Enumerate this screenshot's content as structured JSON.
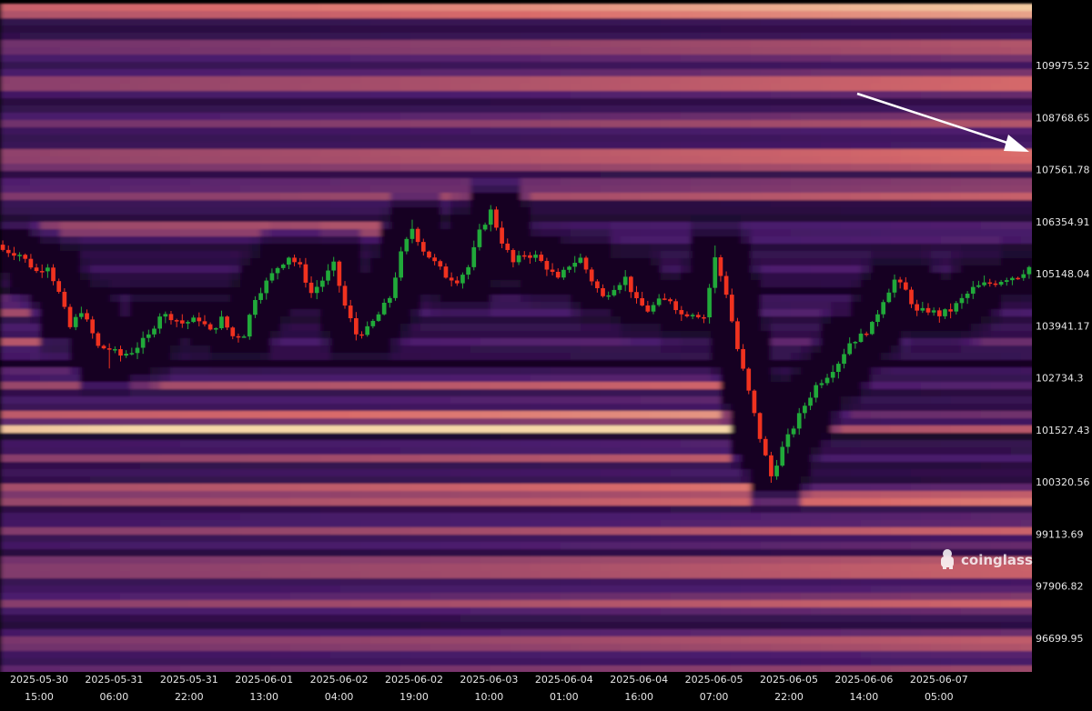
{
  "chart_data": {
    "type": "heatmap",
    "subtype": "liquidation-heatmap-with-candlesticks",
    "title": "",
    "xlabel": "",
    "ylabel": "",
    "y_ticks": [
      "109975.52",
      "108768.65",
      "107561.78",
      "106354.91",
      "105148.04",
      "103941.17",
      "102734.3",
      "101527.43",
      "100320.56",
      "99113.69",
      "97906.82",
      "96699.95"
    ],
    "ylim": [
      95850,
      111750
    ],
    "x_ticks": [
      {
        "date": "2025-05-30",
        "time": "15:00"
      },
      {
        "date": "2025-05-31",
        "time": "06:00"
      },
      {
        "date": "2025-05-31",
        "time": "22:00"
      },
      {
        "date": "2025-06-01",
        "time": "13:00"
      },
      {
        "date": "2025-06-02",
        "time": "04:00"
      },
      {
        "date": "2025-06-02",
        "time": "19:00"
      },
      {
        "date": "2025-06-03",
        "time": "10:00"
      },
      {
        "date": "2025-06-04",
        "time": "01:00"
      },
      {
        "date": "2025-06-04",
        "time": "16:00"
      },
      {
        "date": "2025-06-05",
        "time": "07:00"
      },
      {
        "date": "2025-06-05",
        "time": "22:00"
      },
      {
        "date": "2025-06-06",
        "time": "14:00"
      },
      {
        "date": "2025-06-07",
        "time": "05:00"
      }
    ],
    "candle_interval_hours": 1.6,
    "price_path": [
      [
        0,
        105700
      ],
      [
        3,
        105600
      ],
      [
        6,
        105200
      ],
      [
        8,
        105350
      ],
      [
        10,
        104700
      ],
      [
        12,
        103900
      ],
      [
        14,
        104300
      ],
      [
        16,
        103750
      ],
      [
        17,
        103450
      ],
      [
        19,
        103400
      ],
      [
        21,
        103250
      ],
      [
        23,
        103350
      ],
      [
        26,
        103700
      ],
      [
        28,
        104200
      ],
      [
        30,
        104150
      ],
      [
        32,
        104000
      ],
      [
        35,
        104100
      ],
      [
        37,
        103800
      ],
      [
        39,
        104100
      ],
      [
        41,
        103700
      ],
      [
        43,
        103750
      ],
      [
        45,
        104600
      ],
      [
        47,
        104950
      ],
      [
        49,
        105300
      ],
      [
        51,
        105550
      ],
      [
        53,
        105300
      ],
      [
        55,
        104700
      ],
      [
        57,
        105000
      ],
      [
        59,
        105350
      ],
      [
        61,
        104400
      ],
      [
        63,
        103750
      ],
      [
        65,
        103850
      ],
      [
        67,
        104200
      ],
      [
        69,
        104600
      ],
      [
        71,
        105600
      ],
      [
        73,
        106200
      ],
      [
        75,
        105700
      ],
      [
        77,
        105400
      ],
      [
        79,
        105100
      ],
      [
        81,
        105000
      ],
      [
        83,
        105300
      ],
      [
        85,
        106100
      ],
      [
        87,
        106600
      ],
      [
        89,
        105900
      ],
      [
        91,
        105400
      ],
      [
        93,
        105600
      ],
      [
        95,
        105550
      ],
      [
        97,
        105300
      ],
      [
        99,
        105000
      ],
      [
        101,
        105350
      ],
      [
        103,
        105500
      ],
      [
        105,
        105000
      ],
      [
        107,
        104600
      ],
      [
        109,
        104850
      ],
      [
        111,
        105050
      ],
      [
        113,
        104500
      ],
      [
        115,
        104300
      ],
      [
        117,
        104500
      ],
      [
        119,
        104550
      ],
      [
        121,
        104200
      ],
      [
        123,
        104250
      ],
      [
        125,
        104150
      ],
      [
        127,
        105500
      ],
      [
        129,
        104700
      ],
      [
        131,
        103400
      ],
      [
        133,
        102400
      ],
      [
        135,
        101350
      ],
      [
        137,
        100450
      ],
      [
        139,
        101100
      ],
      [
        141,
        101600
      ],
      [
        143,
        102100
      ],
      [
        145,
        102550
      ],
      [
        147,
        102800
      ],
      [
        149,
        103100
      ],
      [
        151,
        103550
      ],
      [
        153,
        103700
      ],
      [
        155,
        103950
      ],
      [
        157,
        104550
      ],
      [
        159,
        105000
      ],
      [
        161,
        104750
      ],
      [
        163,
        104250
      ],
      [
        165,
        104300
      ],
      [
        167,
        104200
      ],
      [
        169,
        104300
      ],
      [
        171,
        104550
      ],
      [
        173,
        104800
      ],
      [
        175,
        104900
      ],
      [
        177,
        104950
      ],
      [
        179,
        105050
      ],
      [
        181,
        105100
      ],
      [
        183,
        105300
      ]
    ],
    "wick_highs": [
      [
        1,
        105800
      ],
      [
        73,
        106400
      ],
      [
        87,
        106700
      ],
      [
        127,
        105800
      ]
    ],
    "wick_lows": [
      [
        19,
        102950
      ],
      [
        63,
        103600
      ],
      [
        137,
        100300
      ]
    ],
    "legend": "none",
    "watermark": "coinglass",
    "colors": {
      "up": "#21a93a",
      "down": "#f0321f",
      "low": "#12031f",
      "mid": "#4a1c6d",
      "high": "#d96a6a",
      "peak": "#f6d8a8"
    }
  }
}
